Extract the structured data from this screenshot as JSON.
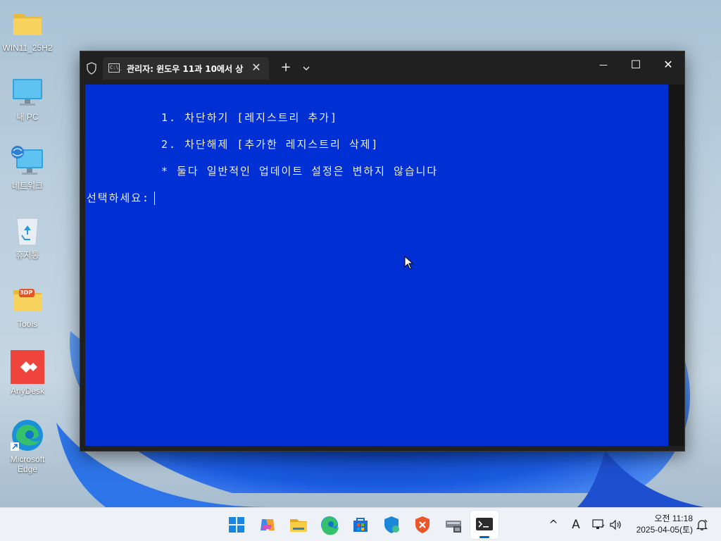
{
  "desktop": {
    "icons": [
      {
        "name": "folder-icon",
        "label": "WIN11_25H2"
      },
      {
        "name": "monitor-icon",
        "label": "내 PC"
      },
      {
        "name": "network-icon",
        "label": "네트워크"
      },
      {
        "name": "recycle-bin-icon",
        "label": "휴지통"
      },
      {
        "name": "folder-tools-icon",
        "label": "Tools",
        "badge": "3DP"
      },
      {
        "name": "anydesk-icon",
        "label": "AnyDesk"
      },
      {
        "name": "edge-icon",
        "label": "Microsoft Edge"
      }
    ]
  },
  "terminal": {
    "tab_title": "관리자:  윈도우 11과 10에서 상",
    "tab_icon_text": "C:\\_",
    "icons": {
      "shield": "shield-icon",
      "tab_close": "close-icon",
      "new_tab": "plus-icon",
      "dropdown": "chevron-down-icon",
      "minimize": "minimize-icon",
      "maximize": "maximize-icon",
      "close": "close-icon"
    },
    "glyphs": {
      "tab_close": "✕",
      "new_tab": "+",
      "minimize": "—",
      "maximize": "☐",
      "close": "✕"
    },
    "lines": [
      "1. 차단하기 [레지스트리 추가]",
      "2. 차단해제 [추가한 레지스트리 삭제]",
      "* 둘다 일반적인 업데이트 설정은 변하지 않습니다",
      "선택하세요:"
    ],
    "colors": {
      "background": "#0030d4",
      "foreground": "#f0f0f0",
      "titlebar": "#202020"
    }
  },
  "taskbar": {
    "apps": [
      {
        "name": "start-icon"
      },
      {
        "name": "copilot-icon"
      },
      {
        "name": "file-explorer-icon"
      },
      {
        "name": "edge-icon"
      },
      {
        "name": "store-icon"
      },
      {
        "name": "defender-icon"
      },
      {
        "name": "security-app-icon"
      },
      {
        "name": "network-drive-icon"
      },
      {
        "name": "terminal-icon",
        "active": true
      }
    ],
    "tray": {
      "chevron": "^",
      "ime": "A",
      "clock_time": "오전 11:18",
      "clock_date": "2025-04-05(토)"
    },
    "colors": {
      "accent": "#0067c0"
    }
  }
}
